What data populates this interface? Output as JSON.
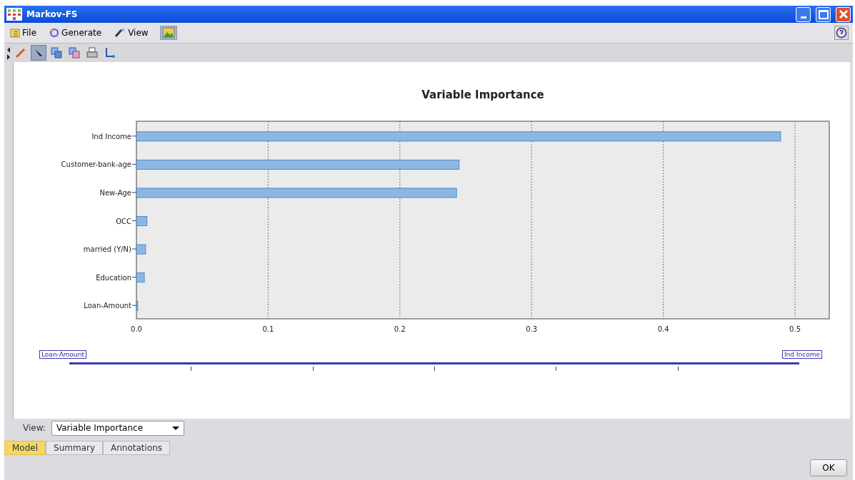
{
  "window": {
    "title": "Markov-FS"
  },
  "menu": [
    "File",
    "Generate",
    "View"
  ],
  "chart": {
    "chart_data": {
      "type": "bar",
      "orientation": "horizontal",
      "title": "Variable Importance",
      "categories": [
        "Ind Income",
        "Customer-bank-age",
        "New-Age",
        "OCC",
        "married (Y/N)",
        "Education",
        "Loan-Amount"
      ],
      "series": [
        {
          "color": "#8db7e2",
          "values": [
            0.489,
            0.245,
            0.243,
            0.008,
            0.007,
            0.006,
            0.001
          ]
        }
      ],
      "grid": true,
      "xlim": [
        0,
        0.526
      ],
      "xticks": [
        {
          "value": 0,
          "label": "0.0"
        },
        {
          "value": 0.1,
          "label": "0.1"
        },
        {
          "value": 0.2,
          "label": "0.2"
        },
        {
          "value": 0.3,
          "label": "0.3"
        },
        {
          "value": 0.4,
          "label": "0.4"
        },
        {
          "value": 0.5,
          "label": "0.5"
        }
      ]
    }
  },
  "range_slider": {
    "min_label": "Loan-Amount",
    "max_label": "Ind Income",
    "level": 1
  },
  "view_selector": {
    "label": "View:",
    "value": "Variable Importance"
  },
  "tabs": [
    {
      "label": "Model",
      "selected": true
    },
    {
      "label": "Summary",
      "selected": false
    },
    {
      "label": "Annotations",
      "selected": false
    }
  ],
  "buttons": [
    "OK"
  ]
}
